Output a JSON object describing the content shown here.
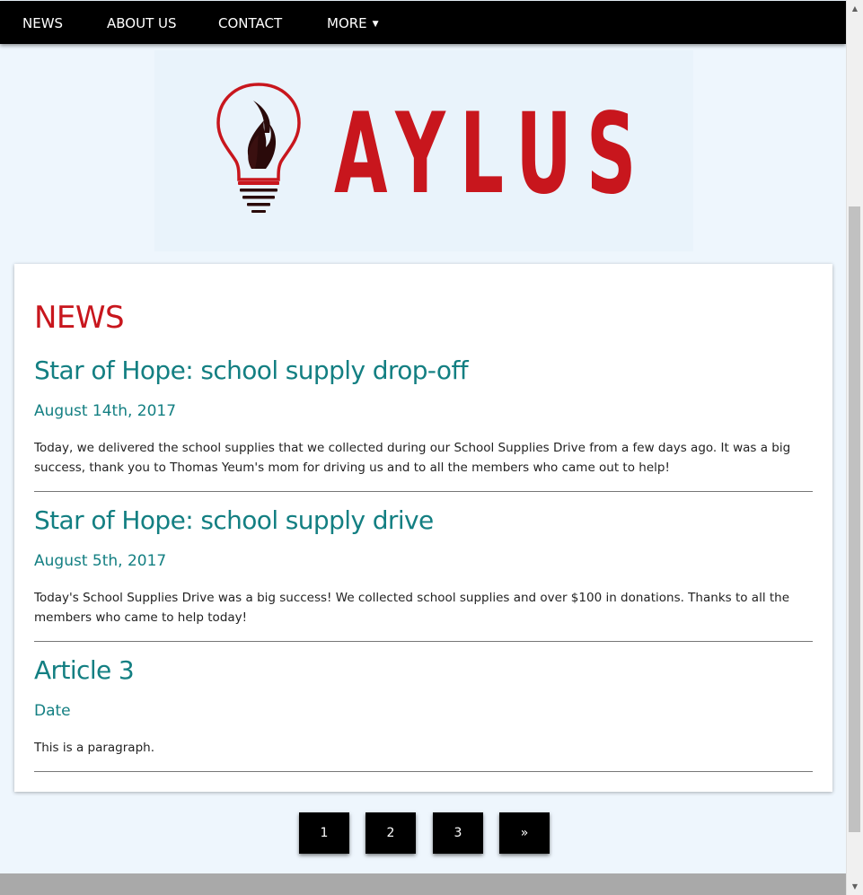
{
  "nav": {
    "items": [
      {
        "label": "NEWS"
      },
      {
        "label": "ABOUT US"
      },
      {
        "label": "CONTACT"
      },
      {
        "label": "MORE"
      }
    ],
    "more_caret": "▼"
  },
  "logo": {
    "wordmark": "AYLUS",
    "colors": {
      "brand_red": "#c8161d",
      "flame": "#2a0a0a"
    }
  },
  "news": {
    "heading": "NEWS",
    "articles": [
      {
        "title": "Star of Hope: school supply drop-off",
        "date": "August 14th, 2017",
        "body": "Today, we delivered the school supplies that we collected during our School Supplies Drive from a few days ago. It was a big success, thank you to Thomas Yeum's mom for driving us and to all the members who came out to help!"
      },
      {
        "title": "Star of Hope: school supply drive",
        "date": "August 5th, 2017",
        "body": "Today's School Supplies Drive was a big success! We collected school supplies and over $100 in donations. Thanks to all the members who came to help today!"
      },
      {
        "title": "Article 3",
        "date": "Date",
        "body": "This is a paragraph."
      }
    ]
  },
  "pagination": {
    "pages": [
      "1",
      "2",
      "3"
    ],
    "next": "»"
  },
  "scrollbar": {
    "up_arrow": "▲",
    "down_arrow": "▼"
  },
  "colors": {
    "accent_teal": "#137f82",
    "heading_red": "#c8161d",
    "nav_bg": "#000000",
    "page_bg": "#eef6fd"
  }
}
